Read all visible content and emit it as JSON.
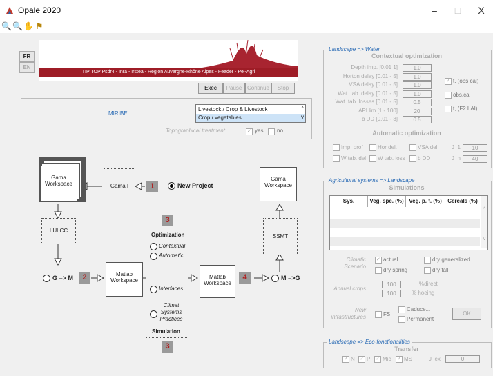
{
  "window": {
    "title": "Opale 2020",
    "min": "–",
    "max": "□",
    "close": "X"
  },
  "lang": {
    "fr": "FR",
    "en": "EN"
  },
  "banner": {
    "text": "TIP TOP Psdr4 - Inra - Irstea - Région Auvergne-Rhône Alpes - Feader - Pei-Agri"
  },
  "controls": {
    "exec": "Exec",
    "pause": "Pause",
    "continue": "Continue",
    "stop": "Stop"
  },
  "site": {
    "name": "MIRIBEL",
    "options": [
      "Livestock / Crop & Livestock",
      "Crop / vegetables"
    ],
    "topo_label": "Topographical treatment",
    "yes": "yes",
    "no": "no"
  },
  "workflow": {
    "gama_ws_left": "Gama Workspace",
    "gama_i": "Gama I",
    "badge1": "1",
    "new_project": "New Project",
    "lulcc": "LULCC",
    "gm": "G => M",
    "badge2": "2",
    "matlab_ws": "Matlab Workspace",
    "badge3": "3",
    "optimization": "Optimization",
    "contextual": "Contextual",
    "automatic": "Automatic",
    "interfaces": "Interfaces",
    "climat": "Climat Systems Practices",
    "simulation": "Simulation",
    "matlab_ws2": "Matlab Workspace",
    "badge4": "4",
    "mg": "M =>G",
    "ssmt": "SSMT",
    "gama_ws_right": "Gama Workspace"
  },
  "water": {
    "title": "Landscape => Water",
    "subtitle": "Contextual optimization",
    "rows": [
      {
        "label": "Depth imp. [0.01 1]",
        "value": "1.0"
      },
      {
        "label": "Horton delay [0.01 - 5]",
        "value": "1.0"
      },
      {
        "label": "VSA delay [0.01 - 5]",
        "value": "1.0"
      },
      {
        "label": "Wat. tab. delay [0.01 - 5]",
        "value": "1.0"
      },
      {
        "label": "Wat. tab. losses [0.01 - 5]",
        "value": "0.5"
      },
      {
        "label": "API lim [1 - 100]",
        "value": "20"
      },
      {
        "label": "b DD [0.01 - 3]",
        "value": "0.5"
      }
    ],
    "checks": [
      "t, (obs cal)",
      "obs,cal",
      "t, (F2 LAI)"
    ],
    "auto_title": "Automatic optimization",
    "auto_row1": [
      "Imp. prof",
      "Hor del.",
      "VSA del."
    ],
    "auto_row2": [
      "W tab. del",
      "W tab. loss",
      "b DD"
    ],
    "j1_label": "J_1",
    "j1_value": "10",
    "jn_label": "J_n",
    "jn_value": "40"
  },
  "agri": {
    "title": "Agricultural systems => Landscape",
    "subtitle": "Simulations",
    "columns": [
      "Sys.",
      "Veg. spe. (%)",
      "Veg. p. f. (%)",
      "Cereals (%)"
    ],
    "climatic": "Climatic Scenario",
    "actual": "actual",
    "dry_spring": "dry spring",
    "dry_generalized": "dry generalized",
    "dry_fall": "dry fall",
    "annual_crops": "Annual crops",
    "direct_value": "100",
    "direct_label": "%direct",
    "hoeing_value": "100",
    "hoeing_label": "% hoeing",
    "new_infra": "New infrastructures",
    "fs": "FS",
    "caduce": "Caduce...",
    "permanent": "Permanent",
    "ok": "OK"
  },
  "eco": {
    "title": "Landscape => Eco-fonctionalities",
    "subtitle": "Transfer",
    "checks": [
      "N",
      "P",
      "Mic",
      "MS"
    ],
    "j_ex_label": "J_ex",
    "j_ex_value": "0"
  },
  "colors": {
    "banner": "#9e1c26",
    "accent": "#2a6bb5",
    "badge_text": "#b01c1c"
  }
}
